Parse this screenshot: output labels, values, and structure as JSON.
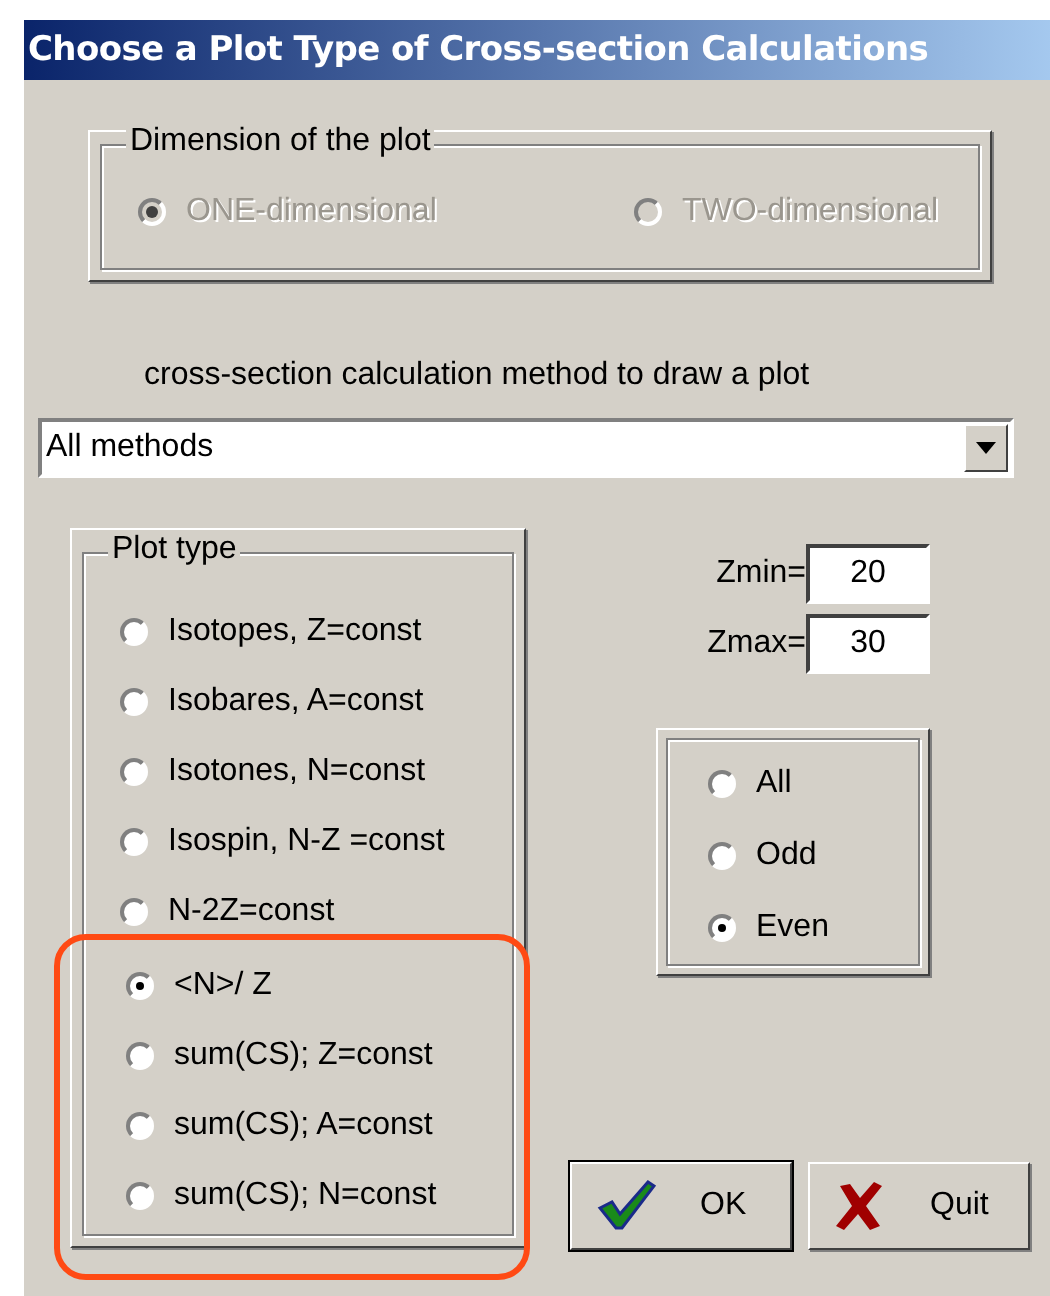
{
  "window": {
    "title": "Choose a Plot Type of Cross-section Calculations"
  },
  "dimension": {
    "label": "Dimension of the plot",
    "options": [
      {
        "label": "ONE-dimensional",
        "selected": true,
        "disabled": true
      },
      {
        "label": "TWO-dimensional",
        "selected": false,
        "disabled": true
      }
    ]
  },
  "method": {
    "label": "cross-section calculation method to draw a plot",
    "value": "All methods"
  },
  "plot_type": {
    "label": "Plot type",
    "options": [
      {
        "label": "Isotopes,  Z=const",
        "selected": false
      },
      {
        "label": "Isobares,  A=const",
        "selected": false
      },
      {
        "label": "Isotones, N=const",
        "selected": false
      },
      {
        "label": "Isospin, N-Z =const",
        "selected": false
      },
      {
        "label": "N-2Z=const",
        "selected": false
      }
    ],
    "highlighted_options": [
      {
        "label": "<N>/ Z",
        "selected": true
      },
      {
        "label": "sum(CS);  Z=const",
        "selected": false
      },
      {
        "label": "sum(CS);  A=const",
        "selected": false
      },
      {
        "label": "sum(CS);  N=const",
        "selected": false
      }
    ]
  },
  "range": [
    {
      "label": "Zmin=",
      "value": "20"
    },
    {
      "label": "Zmax=",
      "value": "30"
    }
  ],
  "parity": {
    "options": [
      {
        "label": "All",
        "selected": false
      },
      {
        "label": "Odd",
        "selected": false
      },
      {
        "label": "Even",
        "selected": true
      }
    ]
  },
  "buttons": [
    {
      "kind": "ok",
      "label": "OK"
    },
    {
      "kind": "quit",
      "label": "Quit"
    }
  ]
}
